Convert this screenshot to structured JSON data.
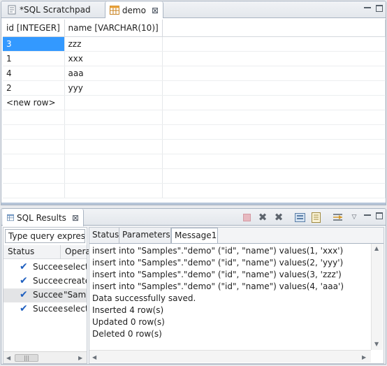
{
  "editor": {
    "tabs": [
      {
        "label": "*SQL Scratchpad",
        "icon": "sql-file-icon",
        "active": false
      },
      {
        "label": "demo",
        "icon": "table-icon",
        "active": true,
        "close": "⊠"
      }
    ]
  },
  "grid": {
    "columns": [
      "id [INTEGER]",
      "name [VARCHAR(10)]"
    ],
    "rows": [
      [
        "3",
        "zzz"
      ],
      [
        "1",
        "xxx"
      ],
      [
        "4",
        "aaa"
      ],
      [
        "2",
        "yyy"
      ]
    ],
    "new_row_label": "<new row>",
    "selected_cell": {
      "row": 0,
      "col": 0
    },
    "selection_color": "#3399ff"
  },
  "results_panel": {
    "tab": {
      "label": "SQL Results",
      "close": "⊠",
      "icon": "sql-results-icon"
    },
    "toolbar_icons": [
      "stop-icon",
      "remove-icon",
      "remove-all-icon",
      "save-icon",
      "export-icon",
      "pin-icon",
      "view-menu-icon"
    ],
    "history": {
      "filter_value": "Type query expres",
      "columns": [
        "Status",
        "Opera"
      ],
      "rows": [
        {
          "status": "Succee",
          "operation": "select",
          "selected": false
        },
        {
          "status": "Succee",
          "operation": "create",
          "selected": false
        },
        {
          "status": "Succee",
          "operation": "\"Samp",
          "selected": true
        },
        {
          "status": "Succee",
          "operation": "select",
          "selected": false
        }
      ],
      "hscroll_thumb": "|||"
    },
    "detail_tabs": [
      {
        "label": "Status",
        "active": false
      },
      {
        "label": "Parameters",
        "active": false
      },
      {
        "label": "Message1",
        "active": true
      }
    ],
    "messages": [
      "insert into \"Samples\".\"demo\" (\"id\", \"name\") values(1, 'xxx')",
      "insert into \"Samples\".\"demo\" (\"id\", \"name\") values(2, 'yyy')",
      "insert into \"Samples\".\"demo\" (\"id\", \"name\") values(3, 'zzz')",
      "insert into \"Samples\".\"demo\" (\"id\", \"name\") values(4, 'aaa')",
      "Data successfully saved.",
      "Inserted 4 row(s)",
      "Updated 0 row(s)",
      "Deleted 0 row(s)"
    ]
  }
}
